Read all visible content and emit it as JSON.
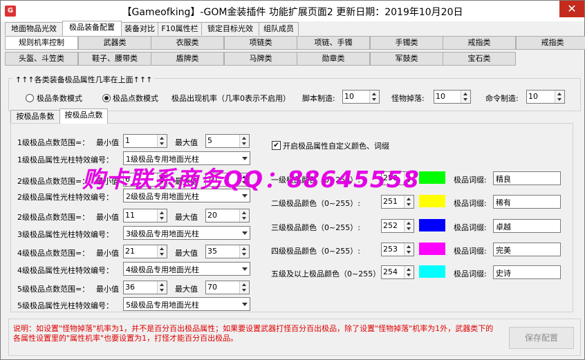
{
  "window": {
    "title": "【Gameofking】-GOM金装插件 功能扩展页面2    更新日期：2019年10月20日",
    "icon": "app-icon",
    "close": "✕"
  },
  "tabs": [
    "地面物品光效",
    "极品装备配置",
    "装备对比",
    "F10属性栏",
    "锁定目标光效",
    "组队成员"
  ],
  "active_tab": "极品装备配置",
  "categories_row1": [
    "规则机率控制",
    "武器类",
    "衣服类",
    "项链类",
    "项链、手镯",
    "手镯类",
    "戒指类",
    "戒指类"
  ],
  "categories_row2": [
    "头盔、斗笠类",
    "鞋子、腰带类",
    "盾牌类",
    "马牌类",
    "勋章类",
    "军鼓类",
    "宝石类"
  ],
  "settings": {
    "group_title": "↑↑↑各类装备极品属性几率在上面↑↑↑",
    "mode_count": "极品条数模式",
    "mode_points": "极品点数模式",
    "rate_label": "极品出现机率（几率0表示不启用）",
    "script_label": "脚本制造:",
    "script_value": "10",
    "monster_label": "怪物掉落:",
    "monster_value": "10",
    "command_label": "命令制造:",
    "command_value": "10"
  },
  "subtabs": [
    "按极品条数",
    "按极品点数"
  ],
  "levels": [
    {
      "range_label": "1级极品点数范围=：",
      "min_label": "最小值",
      "min": "1",
      "max_label": "最大值",
      "max": "5",
      "effect_label": "1级极品属性光柱特效编号：",
      "effect": "1级极品专用地面光柱"
    },
    {
      "range_label": "2级极品点数范围=：",
      "min_label": "最小值",
      "min": "6",
      "max_label": "最大值",
      "max": "10",
      "effect_label": "2级极品属性光柱特效编号：",
      "effect": "2级极品专用地面光柱"
    },
    {
      "range_label": "2级极品点数范围=：",
      "min_label": "最小值",
      "min": "11",
      "max_label": "最大值",
      "max": "20",
      "effect_label": "3级极品属性光柱特效编号：",
      "effect": "3级极品专用地面光柱"
    },
    {
      "range_label": "4级极品点数范围=：",
      "min_label": "最小值",
      "min": "21",
      "max_label": "最大值",
      "max": "35",
      "effect_label": "4级极品属性光柱特效编号：",
      "effect": "4级极品专用地面光柱"
    },
    {
      "range_label": "5级极品点数范围=：",
      "min_label": "最小值",
      "min": "36",
      "max_label": "最大值",
      "max": "70",
      "effect_label": "5级极品属性光柱特效编号：",
      "effect": "5级极品专用地面光柱"
    }
  ],
  "custom": {
    "checkbox_label": "开启极品属性自定义颜色、词缀",
    "checked": true,
    "rows": [
      {
        "label": "一级极品颜色（0~255）:",
        "value": "250",
        "color": "#00ff00",
        "word_label": "极品词缀:",
        "word": "精良"
      },
      {
        "label": "二级极品颜色（0~255）:",
        "value": "251",
        "color": "#ffff00",
        "word_label": "极品词缀:",
        "word": "稀有"
      },
      {
        "label": "三级极品颜色（0~255）:",
        "value": "252",
        "color": "#0000ff",
        "word_label": "极品词缀:",
        "word": "卓越"
      },
      {
        "label": "四级极品颜色（0~255）:",
        "value": "253",
        "color": "#ff00ff",
        "word_label": "极品词缀:",
        "word": "完美"
      },
      {
        "label": "五级及以上极品颜色（0~255）:",
        "value": "254",
        "color": "#00ffff",
        "word_label": "极品词缀:",
        "word": "史诗"
      }
    ]
  },
  "watermark": "购卡联系商务QQ：88645558",
  "note": "说明：如设置\"怪物掉落\"机率为1，并不是百分百出极品属性；如果要设置武器打怪百分百出极品，除了设置\"怪物掉落\"机率为1外，武器类下的各属性设置里的\"属性机率\"也要设置为1，打怪才能百分百出极品。",
  "save_button": "保存配置"
}
